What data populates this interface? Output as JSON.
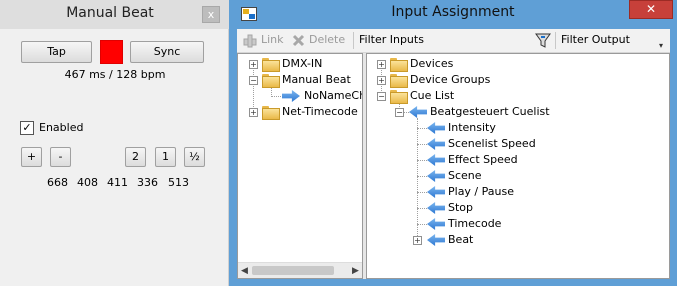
{
  "manual_beat": {
    "title": "Manual Beat",
    "close": "x",
    "tap_label": "Tap",
    "sync_label": "Sync",
    "indicator_color": "#ff0000",
    "timing": "467 ms / 128 bpm",
    "enabled_label": "Enabled",
    "enabled_checked": true,
    "check_mark": "✓",
    "plus_label": "+",
    "minus_label": "-",
    "double_label": "2",
    "one_label": "1",
    "half_label": "½",
    "intervals": [
      "668",
      "408",
      "411",
      "336",
      "513"
    ]
  },
  "input_assignment": {
    "title": "Input Assignment",
    "close": "✕",
    "toolbar": {
      "link_label": "Link",
      "delete_label": "Delete",
      "filter_inputs_label": "Filter Inputs",
      "filter_output_label": "Filter Output",
      "dropdown": "▾"
    },
    "left_tree": [
      {
        "label": "DMX-IN",
        "expander": "+"
      },
      {
        "label": "Manual Beat",
        "expander": "−"
      },
      {
        "label": "NoNameCh"
      },
      {
        "label": "Net-Timecode",
        "expander": "+"
      }
    ],
    "right_tree": {
      "devices": "Devices",
      "device_groups": "Device Groups",
      "cue_list": "Cue List",
      "cuelist_name": "Beatgesteuert Cuelist",
      "inputs": [
        "Intensity",
        "Scenelist Speed",
        "Effect Speed",
        "Scene",
        "Play / Pause",
        "Stop",
        "Timecode",
        "Beat"
      ],
      "plus": "+",
      "minus": "−"
    },
    "scroll": {
      "left": "◀",
      "right": "▶"
    },
    "accent_color": "#5f9fd6"
  }
}
